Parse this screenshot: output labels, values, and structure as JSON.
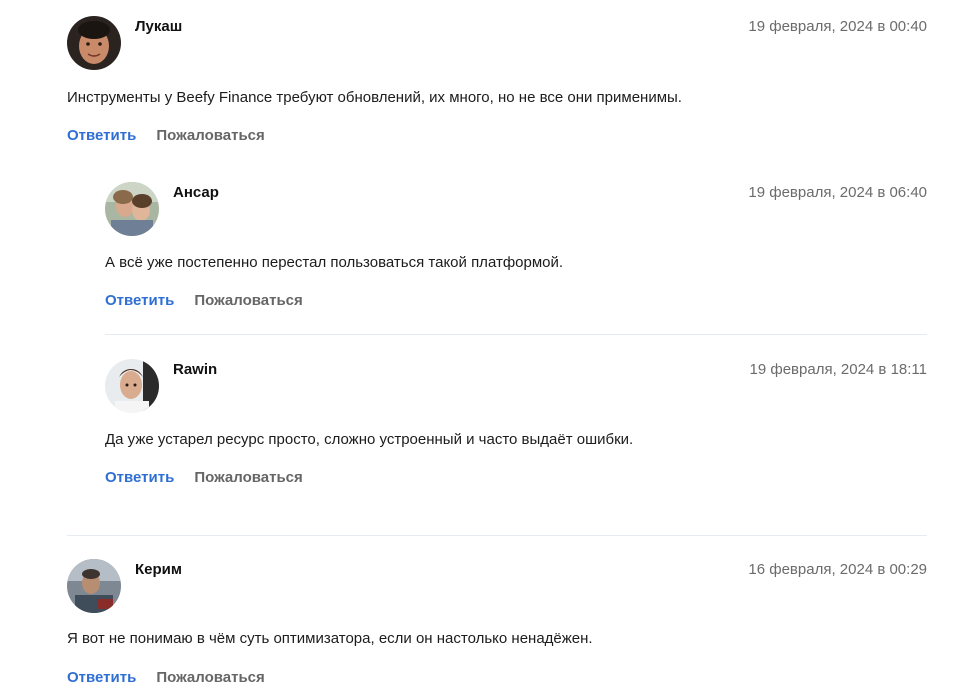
{
  "comments": [
    {
      "author": "Лукаш",
      "date": "19 февраля, 2024 в 00:40",
      "text": "Инструменты у Beefy Finance требуют обновлений, их много, но не все они применимы.",
      "reply_label": "Ответить",
      "report_label": "Пожаловаться"
    },
    {
      "author": "Ансар",
      "date": "19 февраля, 2024 в 06:40",
      "text": "А всё уже постепенно перестал пользоваться такой платформой.",
      "reply_label": "Ответить",
      "report_label": "Пожаловаться"
    },
    {
      "author": "Rawin",
      "date": "19 февраля, 2024 в 18:11",
      "text": "Да уже устарел ресурс просто, сложно устроенный и часто выдаёт ошибки.",
      "reply_label": "Ответить",
      "report_label": "Пожаловаться"
    },
    {
      "author": "Керим",
      "date": "16 февраля, 2024 в 00:29",
      "text": "Я вот не понимаю в чём суть оптимизатора, если он настолько ненадёжен.",
      "reply_label": "Ответить",
      "report_label": "Пожаловаться"
    }
  ],
  "colors": {
    "reply_link": "#2f6fd3",
    "report_link": "#666666",
    "date_text": "#6b6b6b",
    "divider": "#e6ebf2"
  }
}
